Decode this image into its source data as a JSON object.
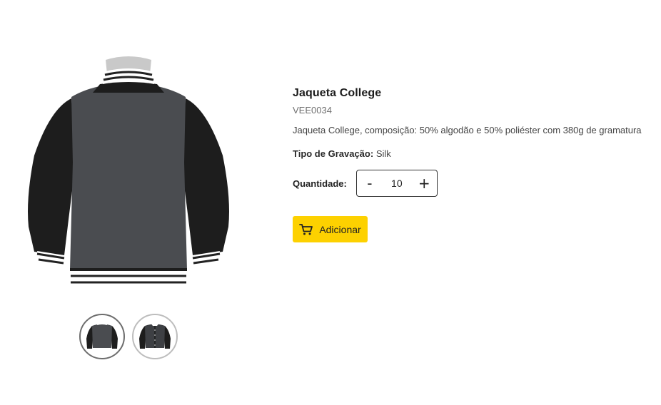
{
  "product": {
    "title": "Jaqueta College",
    "sku": "VEE0034",
    "description": "Jaqueta College, composição: 50% algodão e 50% poliéster com 380g de gramatura",
    "engraving_label": "Tipo de Gravação:",
    "engraving_value": "Silk"
  },
  "quantity": {
    "label": "Quantidade:",
    "decrement": "-",
    "increment": "+",
    "value": "10"
  },
  "cart": {
    "add_label": "Adicionar",
    "icon": "cart-icon",
    "button_color": "#fdd100"
  },
  "gallery": {
    "main_image": "jacket-back-view",
    "thumbnails": [
      "jacket-back-view",
      "jacket-front-view"
    ],
    "active_index": 0
  }
}
